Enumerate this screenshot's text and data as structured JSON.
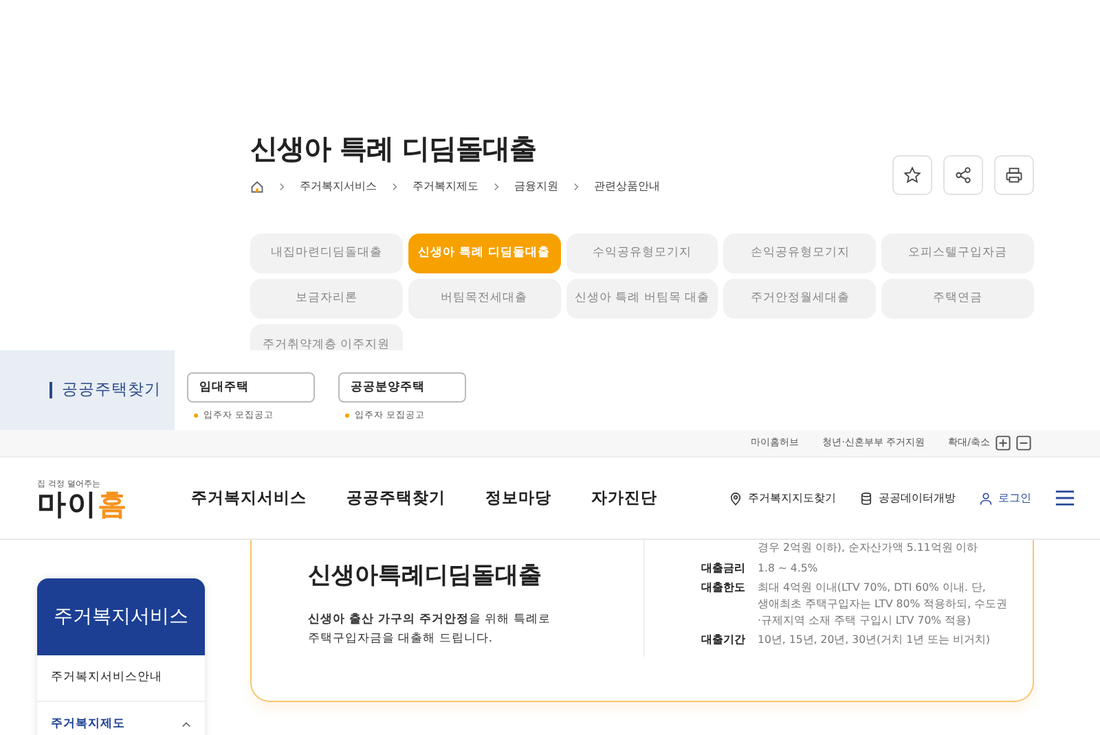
{
  "page_header": {
    "title": "신생아 특례 디딤돌대출",
    "breadcrumb": [
      "주거복지서비스",
      "주거복지제도",
      "금융지원",
      "관련상품안내"
    ]
  },
  "product_tabs": [
    {
      "label": "내집마련디딤돌대출",
      "selected": false
    },
    {
      "label": "신생아 특례 디딤돌대출",
      "selected": true
    },
    {
      "label": "수익공유형모기지",
      "selected": false
    },
    {
      "label": "손익공유형모기지",
      "selected": false
    },
    {
      "label": "오피스텔구입자금",
      "selected": false
    },
    {
      "label": "보금자리론",
      "selected": false
    },
    {
      "label": "버팀목전세대출",
      "selected": false
    },
    {
      "label": "신생아 특례 버팀목 대출",
      "selected": false
    },
    {
      "label": "주거안정월세대출",
      "selected": false
    },
    {
      "label": "주택연금",
      "selected": false
    },
    {
      "label": "주거취약계층 이주지원",
      "selected": false
    }
  ],
  "housing_menu": {
    "title": "공공주택찾기",
    "groups": [
      {
        "title": "임대주택",
        "links": [
          "입주자 모집공고"
        ]
      },
      {
        "title": "공공분양주택",
        "links": [
          "입주자 모집공고"
        ]
      }
    ]
  },
  "utility_bar": {
    "links": [
      "마이홈허브",
      "청년·신혼부부 주거지원"
    ],
    "zoom_label": "확대/축소"
  },
  "header": {
    "logo_tagline": "집 걱정 덜어주는",
    "logo_text": "마이",
    "logo_accent": "홈",
    "nav": [
      "주거복지서비스",
      "공공주택찾기",
      "정보마당",
      "자가진단"
    ],
    "actions": [
      {
        "kind": "map",
        "label": "주거복지지도찾기"
      },
      {
        "kind": "data",
        "label": "공공데이터개방"
      },
      {
        "kind": "login",
        "label": "로그인"
      }
    ]
  },
  "sidebar": {
    "title": "주거복지서비스",
    "items": [
      {
        "label": "주거복지서비스안내"
      },
      {
        "label": "주거복지제도",
        "expanded": true
      }
    ]
  },
  "product": {
    "title": "신생아특례디딤돌대출",
    "description": [
      "**신생아 출산 가구의 주거안정**을 위해 특례로",
      "주택구입자금을 대출해 드립니다."
    ],
    "details": [
      {
        "value": [
          "경우 2억원 이하), 순자산가액 5.11억원 이하"
        ]
      },
      {
        "label": "대출금리",
        "value": [
          "1.8 ~ 4.5%"
        ]
      },
      {
        "label": "대출한도",
        "value": [
          "최대 4억원 이내(LTV 70%, DTI 60% 이내. 단,",
          "생애최초 주택구입자는 LTV 80% 적용하되, 수도권",
          "·규제지역 소재 주택 구입시 LTV 70% 적용)"
        ]
      },
      {
        "label": "대출기간",
        "value": [
          "10년, 15년, 20년, 30년(거치 1년 또는 비거치)"
        ]
      }
    ]
  }
}
